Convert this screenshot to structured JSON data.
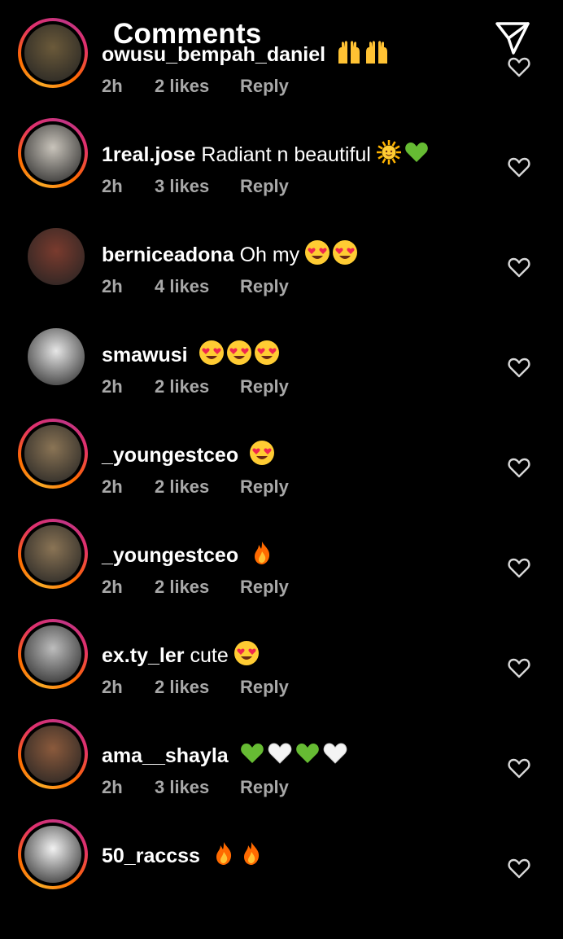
{
  "header": {
    "title": "Comments"
  },
  "comments": [
    {
      "username": "owusu_bempah_daniel",
      "text": "",
      "emojis": [
        "raised-hands",
        "raised-hands"
      ],
      "time": "2h",
      "likes": "2 likes",
      "reply": "Reply",
      "ring": true,
      "avatar_color": "#6b5a3a"
    },
    {
      "username": "1real.jose",
      "text": "Radiant n beautiful",
      "emojis": [
        "sun",
        "green-heart"
      ],
      "time": "2h",
      "likes": "3 likes",
      "reply": "Reply",
      "ring": true,
      "avatar_color": "#c9c4bb"
    },
    {
      "username": "berniceadona",
      "text": "Oh my",
      "emojis": [
        "heart-eyes",
        "heart-eyes"
      ],
      "time": "2h",
      "likes": "4 likes",
      "reply": "Reply",
      "ring": false,
      "avatar_color": "#7a3b2e"
    },
    {
      "username": "smawusi",
      "text": "",
      "emojis": [
        "heart-eyes",
        "heart-eyes",
        "heart-eyes"
      ],
      "time": "2h",
      "likes": "2 likes",
      "reply": "Reply",
      "ring": false,
      "avatar_color": "#e6e6e6"
    },
    {
      "username": "_youngestceo",
      "text": "",
      "emojis": [
        "heart-eyes"
      ],
      "time": "2h",
      "likes": "2 likes",
      "reply": "Reply",
      "ring": true,
      "avatar_color": "#8a7455"
    },
    {
      "username": "_youngestceo",
      "text": "",
      "emojis": [
        "fire"
      ],
      "time": "2h",
      "likes": "2 likes",
      "reply": "Reply",
      "ring": true,
      "avatar_color": "#8a7455"
    },
    {
      "username": "ex.ty_ler",
      "text": "cute",
      "emojis": [
        "heart-eyes"
      ],
      "time": "2h",
      "likes": "2 likes",
      "reply": "Reply",
      "ring": true,
      "avatar_color": "#bdbdbd"
    },
    {
      "username": "ama__shayla",
      "text": "",
      "emojis": [
        "green-heart",
        "white-heart",
        "green-heart",
        "white-heart"
      ],
      "time": "2h",
      "likes": "3 likes",
      "reply": "Reply",
      "ring": true,
      "avatar_color": "#8b5a3c"
    },
    {
      "username": "50_raccss",
      "text": "",
      "emojis": [
        "fire",
        "fire"
      ],
      "time": "",
      "likes": "",
      "reply": "",
      "ring": true,
      "avatar_color": "#f2f2f2"
    }
  ]
}
